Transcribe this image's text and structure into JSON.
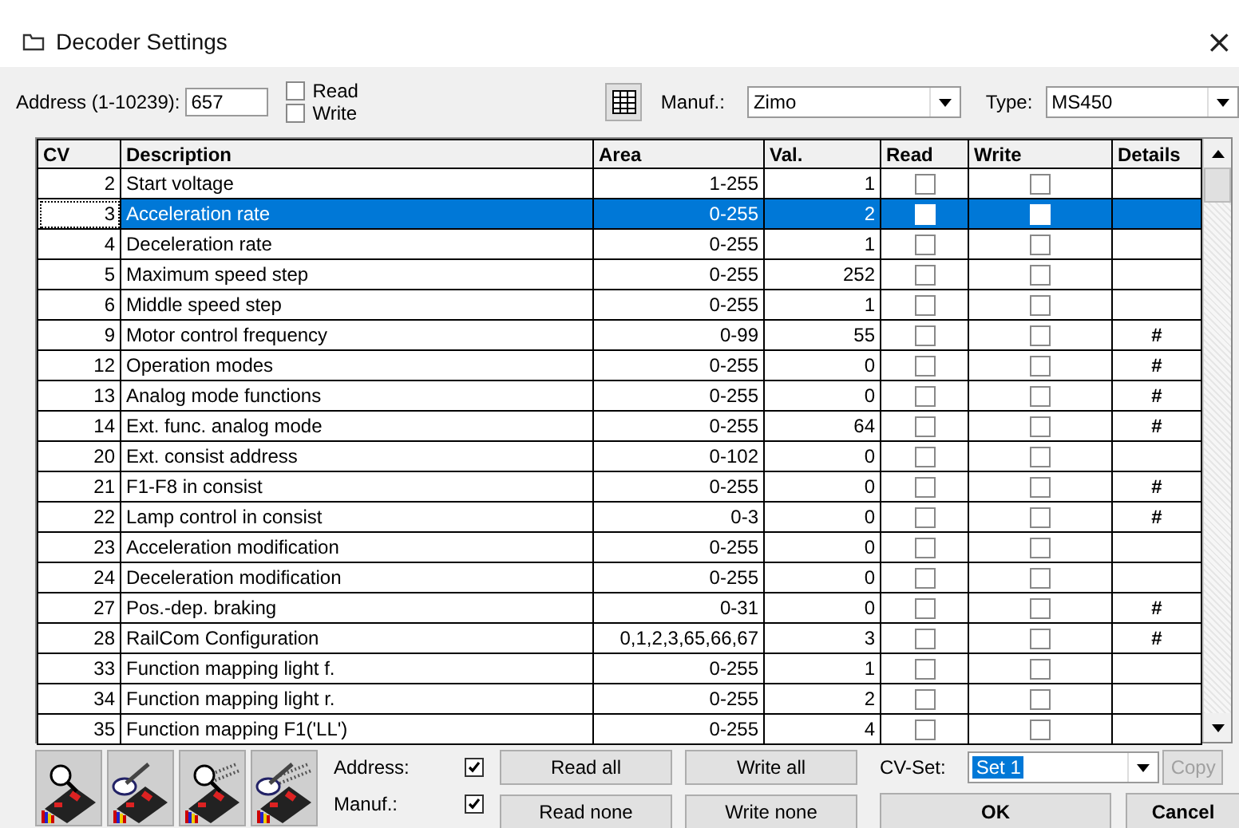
{
  "window": {
    "title": "Decoder Settings",
    "close": "×"
  },
  "address": {
    "label": "Address (1-10239):",
    "value": "657"
  },
  "mode_checks": [
    {
      "label": "Read",
      "checked": false
    },
    {
      "label": "Write",
      "checked": false
    }
  ],
  "manufacturer": {
    "label": "Manuf.:",
    "value": "Zimo"
  },
  "type": {
    "label": "Type:",
    "value": "MS450"
  },
  "table": {
    "columns": [
      "CV",
      "Description",
      "Area",
      "Val.",
      "Read",
      "Write",
      "Details"
    ],
    "rows": [
      {
        "cv": "2",
        "description": "Start voltage",
        "area": "1-255",
        "val": "1",
        "read": false,
        "write": false,
        "details": "",
        "selected": false
      },
      {
        "cv": "3",
        "description": "Acceleration rate",
        "area": "0-255",
        "val": "2",
        "read": false,
        "write": false,
        "details": "",
        "selected": true
      },
      {
        "cv": "4",
        "description": "Deceleration rate",
        "area": "0-255",
        "val": "1",
        "read": false,
        "write": false,
        "details": "",
        "selected": false
      },
      {
        "cv": "5",
        "description": "Maximum speed step",
        "area": "0-255",
        "val": "252",
        "read": false,
        "write": false,
        "details": "",
        "selected": false
      },
      {
        "cv": "6",
        "description": "Middle speed step",
        "area": "0-255",
        "val": "1",
        "read": false,
        "write": false,
        "details": "",
        "selected": false
      },
      {
        "cv": "9",
        "description": "Motor control frequency",
        "area": "0-99",
        "val": "55",
        "read": false,
        "write": false,
        "details": "#",
        "selected": false
      },
      {
        "cv": "12",
        "description": "Operation modes",
        "area": "0-255",
        "val": "0",
        "read": false,
        "write": false,
        "details": "#",
        "selected": false
      },
      {
        "cv": "13",
        "description": "Analog mode functions",
        "area": "0-255",
        "val": "0",
        "read": false,
        "write": false,
        "details": "#",
        "selected": false
      },
      {
        "cv": "14",
        "description": "Ext. func. analog mode",
        "area": "0-255",
        "val": "64",
        "read": false,
        "write": false,
        "details": "#",
        "selected": false
      },
      {
        "cv": "20",
        "description": "Ext. consist address",
        "area": "0-102",
        "val": "0",
        "read": false,
        "write": false,
        "details": "",
        "selected": false
      },
      {
        "cv": "21",
        "description": "F1-F8 in consist",
        "area": "0-255",
        "val": "0",
        "read": false,
        "write": false,
        "details": "#",
        "selected": false
      },
      {
        "cv": "22",
        "description": "Lamp control in consist",
        "area": "0-3",
        "val": "0",
        "read": false,
        "write": false,
        "details": "#",
        "selected": false
      },
      {
        "cv": "23",
        "description": "Acceleration modification",
        "area": "0-255",
        "val": "0",
        "read": false,
        "write": false,
        "details": "",
        "selected": false
      },
      {
        "cv": "24",
        "description": "Deceleration modification",
        "area": "0-255",
        "val": "0",
        "read": false,
        "write": false,
        "details": "",
        "selected": false
      },
      {
        "cv": "27",
        "description": "Pos.-dep. braking",
        "area": "0-31",
        "val": "0",
        "read": false,
        "write": false,
        "details": "#",
        "selected": false
      },
      {
        "cv": "28",
        "description": "RailCom Configuration",
        "area": "0,1,2,3,65,66,67",
        "val": "3",
        "read": false,
        "write": false,
        "details": "#",
        "selected": false
      },
      {
        "cv": "33",
        "description": "Function mapping light f.",
        "area": "0-255",
        "val": "1",
        "read": false,
        "write": false,
        "details": "",
        "selected": false
      },
      {
        "cv": "34",
        "description": "Function mapping light r.",
        "area": "0-255",
        "val": "2",
        "read": false,
        "write": false,
        "details": "",
        "selected": false
      },
      {
        "cv": "35",
        "description": "Function mapping F1('LL')",
        "area": "0-255",
        "val": "4",
        "read": false,
        "write": false,
        "details": "",
        "selected": false
      }
    ]
  },
  "option_checks": [
    {
      "label": "Address:",
      "checked": true
    },
    {
      "label": "Manuf.:",
      "checked": true
    }
  ],
  "read_buttons": [
    "Read all",
    "Read none"
  ],
  "write_buttons": [
    "Write all",
    "Write none"
  ],
  "cv_set": {
    "label": "CV-Set:",
    "value": "Set 1"
  },
  "copy_button": {
    "label": "Copy",
    "disabled": true
  },
  "dialog_buttons": [
    "OK",
    "Cancel"
  ]
}
